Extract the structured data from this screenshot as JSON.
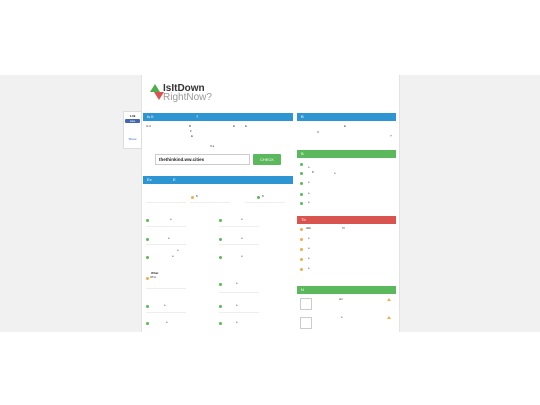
{
  "social": {
    "count": "1.6k",
    "like_label": "Like",
    "share_label": "Share"
  },
  "logo": {
    "line1": "IsItDown",
    "line2": "RightNow?"
  },
  "check_panel": {
    "title": "Is It",
    "title_mark": "?",
    "intro": [
      "Is It",
      "B",
      "E",
      "E"
    ],
    "line2": [
      "F",
      "E"
    ],
    "line3": "If a",
    "input_value": "thethinkind.ww.cities",
    "button_label": "CHECK"
  },
  "recent_panel": {
    "title": "Ex",
    "title_mark": "E"
  },
  "sites_left": [
    {
      "a": "B",
      "b": "B"
    },
    {
      "a": "a",
      "b": ""
    },
    {
      "a": "a",
      "b": "a"
    },
    {
      "a": "a",
      "b": "a"
    }
  ],
  "what_box": {
    "title": "What",
    "item": "Whol"
  },
  "side_top": {
    "title": "B",
    "line1": "E",
    "line2": "C",
    "mark": "?"
  },
  "side_up": {
    "title": "B",
    "items": [
      "a",
      "B",
      "a",
      "a",
      "a",
      "a"
    ]
  },
  "side_down": {
    "title": "Tb",
    "items": [
      "nhh",
      "a",
      "a",
      "a",
      "a"
    ],
    "mark": "Tb"
  },
  "side_news": {
    "title": "N",
    "items": [
      {
        "text": "aht"
      },
      {
        "text": "a"
      }
    ]
  },
  "colors": {
    "blue": "#2e95d3",
    "green": "#5cb85c",
    "red": "#d9534f",
    "orange": "#f0ad4e"
  }
}
